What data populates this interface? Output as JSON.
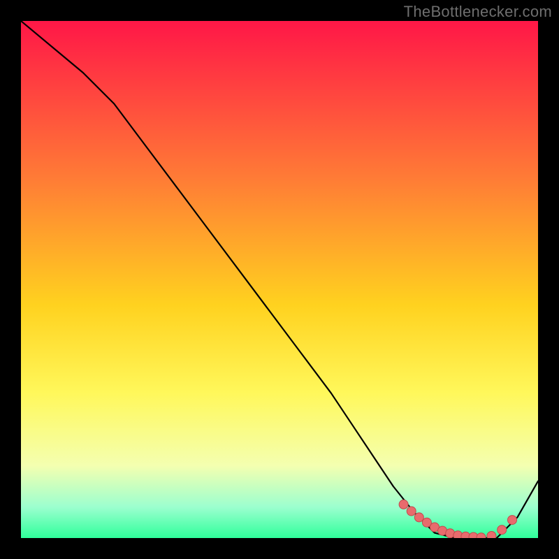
{
  "watermark": "TheBottlenecker.com",
  "colors": {
    "bg": "#000000",
    "curve": "#000000",
    "marker_fill": "#e86b6d",
    "marker_stroke": "#c14a4c",
    "gradient_top": "#ff1747",
    "gradient_mid1": "#ff7a36",
    "gradient_mid2": "#ffd21f",
    "gradient_mid3": "#fff85b",
    "gradient_mid4": "#f4ffb0",
    "gradient_bot1": "#9cffcf",
    "gradient_bot2": "#2fff9b"
  },
  "chart_data": {
    "type": "line",
    "title": "",
    "xlabel": "",
    "ylabel": "",
    "xlim": [
      0,
      100
    ],
    "ylim": [
      0,
      100
    ],
    "series": [
      {
        "name": "bottleneck-curve",
        "x": [
          0,
          6,
          12,
          18,
          24,
          30,
          36,
          42,
          48,
          54,
          60,
          64,
          68,
          72,
          76,
          80,
          84,
          88,
          92,
          96,
          100
        ],
        "y": [
          100,
          95,
          90,
          84,
          76,
          68,
          60,
          52,
          44,
          36,
          28,
          22,
          16,
          10,
          5,
          1,
          0,
          0,
          0,
          4,
          11
        ]
      }
    ],
    "markers": {
      "name": "highlighted-points",
      "x": [
        74,
        75.5,
        77,
        78.5,
        80,
        81.5,
        83,
        84.5,
        86,
        87.5,
        89,
        91,
        93,
        95
      ],
      "y": [
        6.5,
        5.2,
        4.0,
        3.0,
        2.1,
        1.4,
        0.9,
        0.5,
        0.3,
        0.2,
        0.1,
        0.4,
        1.6,
        3.5
      ]
    }
  }
}
